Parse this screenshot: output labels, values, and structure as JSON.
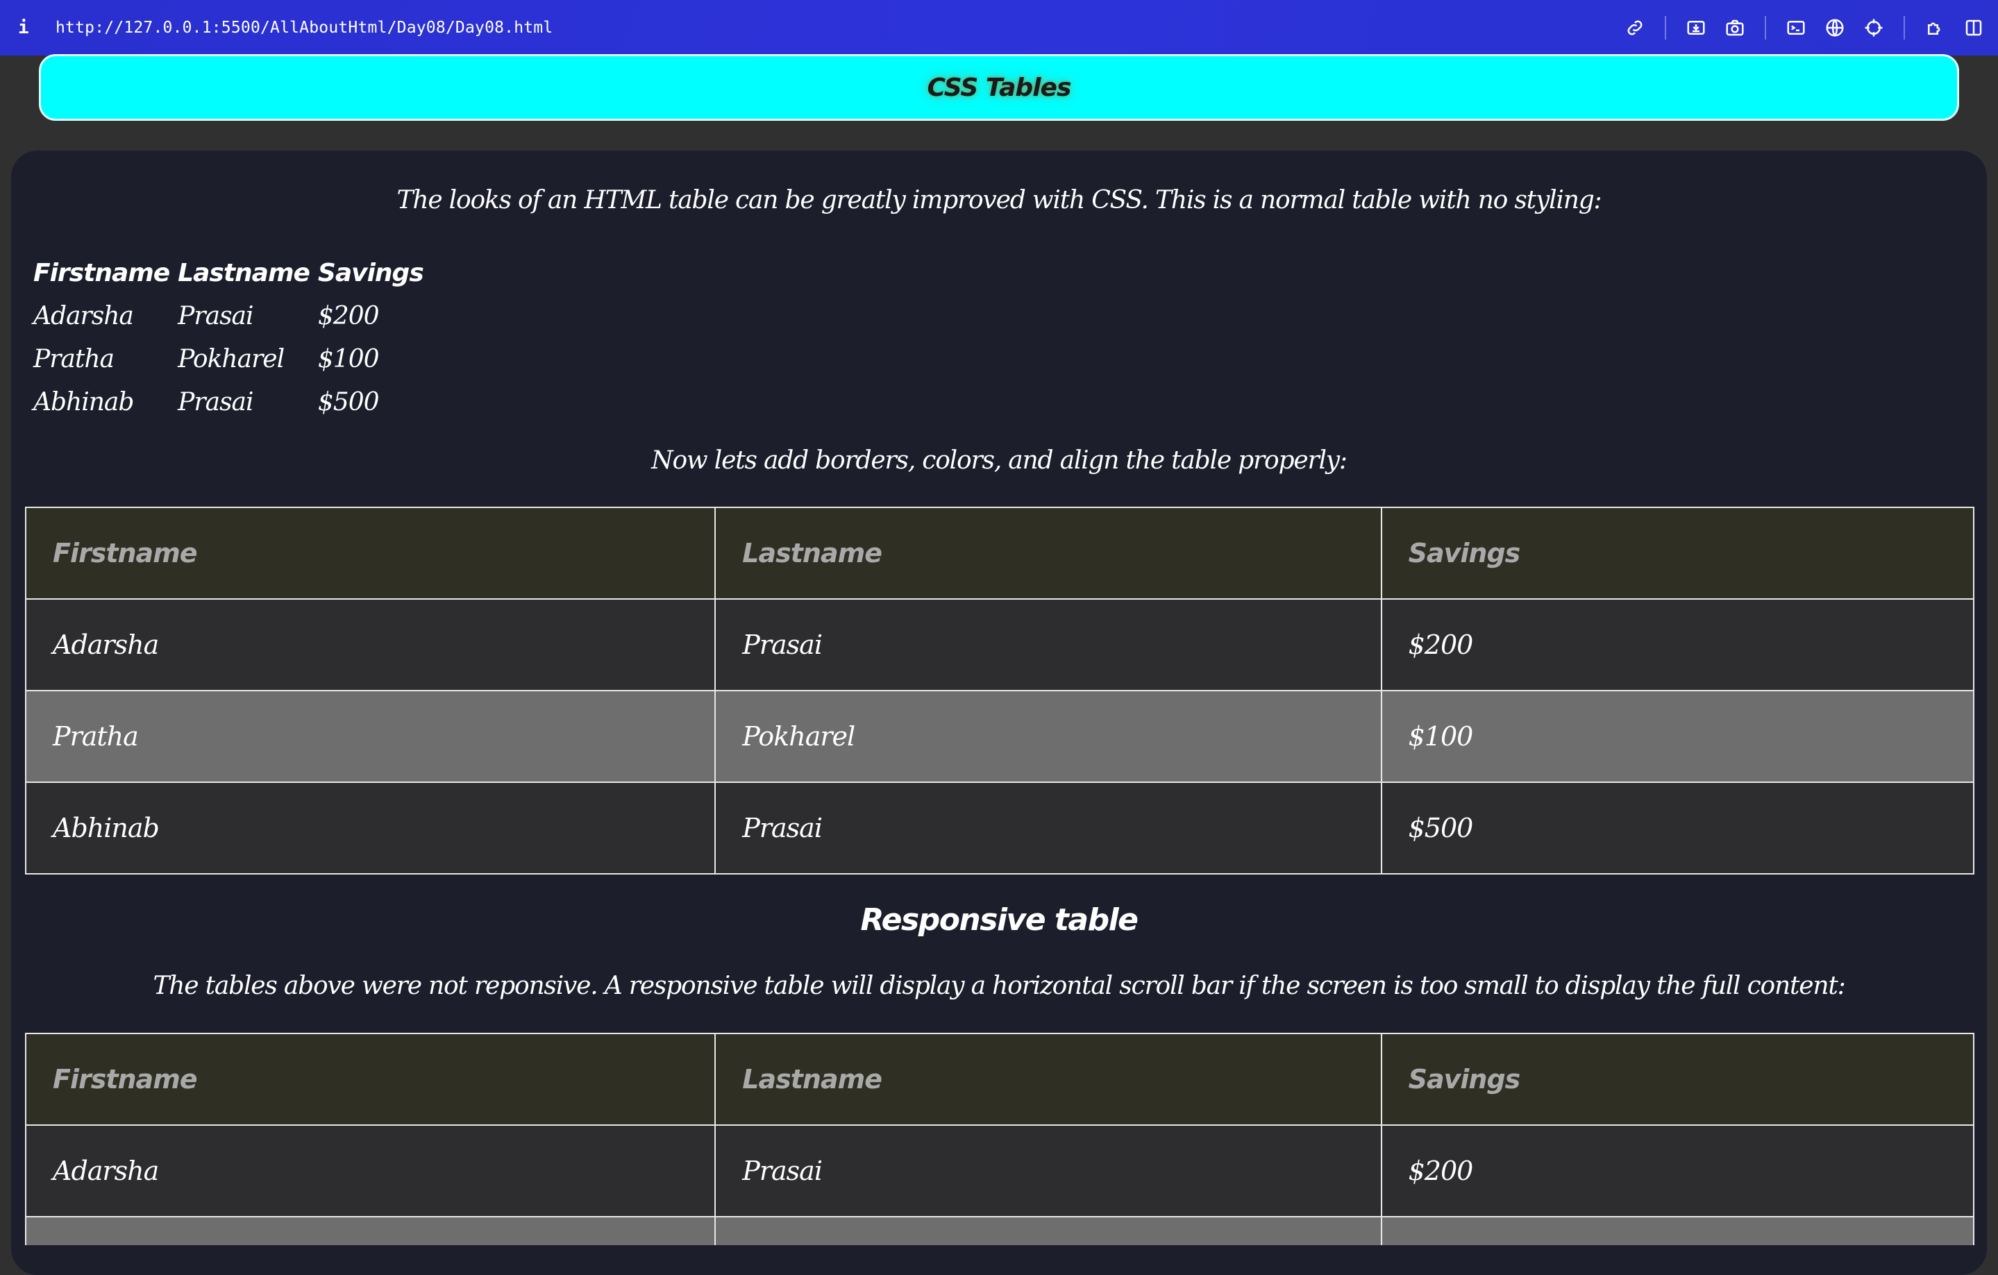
{
  "browser": {
    "info_glyph": "i",
    "url": "http://127.0.0.1:5500/AllAboutHtml/Day08/Day08.html",
    "toolbar_icons": [
      "link-icon",
      "install-icon",
      "camera-icon",
      "terminal-icon",
      "globe-icon",
      "crosshair-icon",
      "extensions-icon",
      "sidebar-icon"
    ]
  },
  "header": {
    "title": "CSS Tables"
  },
  "intro_text": "The looks of an HTML table can be greatly improved with CSS. This is a normal table with no styling:",
  "table_columns": [
    "Firstname",
    "Lastname",
    "Savings"
  ],
  "table_rows": [
    [
      "Adarsha",
      "Prasai",
      "$200"
    ],
    [
      "Pratha",
      "Pokharel",
      "$100"
    ],
    [
      "Abhinab",
      "Prasai",
      "$500"
    ]
  ],
  "styled_intro": "Now lets add borders, colors, and align the table properly:",
  "responsive": {
    "title": "Responsive table",
    "text": "The tables above were not reponsive. A responsive table will display a horizontal scroll bar if the screen is too small to display the full content:"
  },
  "colors": {
    "browser_bar": "#2c33d9",
    "header_bg": "#00ffff",
    "panel_bg": "#1c1e2c",
    "page_bg": "#303030",
    "th_bg": "#2f2f24",
    "row_bg": "#2d2d2f",
    "row_alt_bg": "#6e6e6e"
  }
}
